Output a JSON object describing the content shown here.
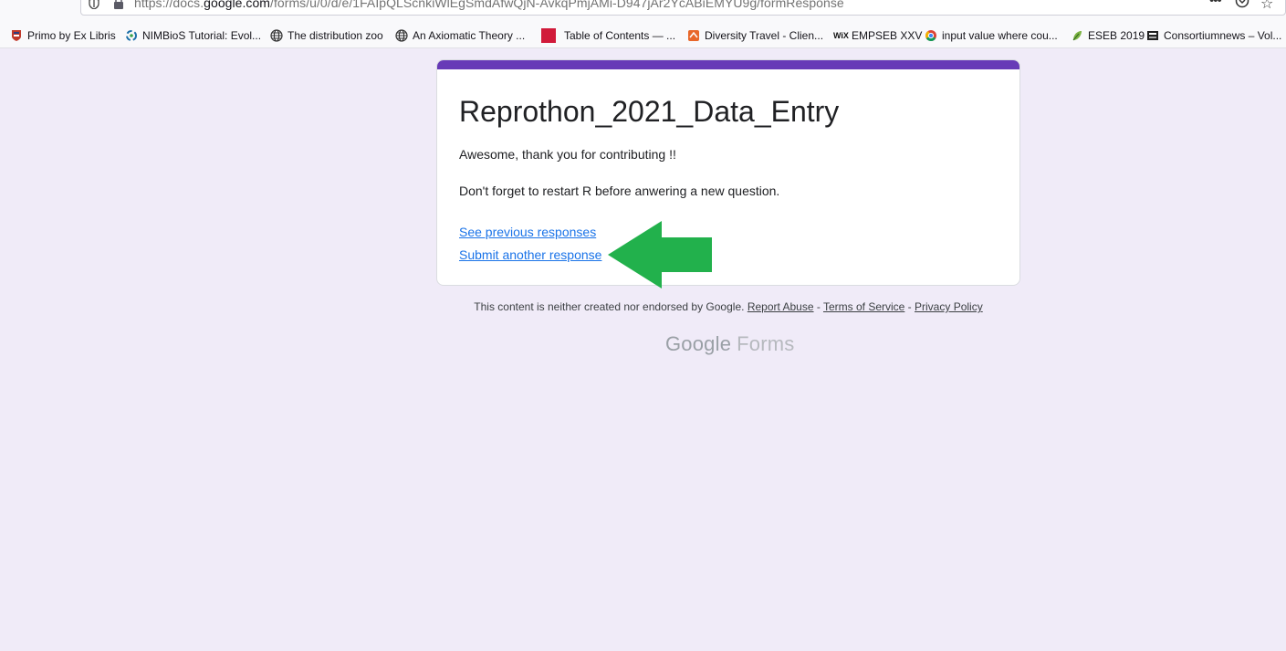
{
  "browser": {
    "url_prefix": "https://docs.",
    "url_host": "google.com",
    "url_path": "/forms/u/0/d/e/1FAIpQLScnkiWlEgSmdAfwQjN-AvkqPmjAMi-D947jAr2YcABiEMYU9g/formResponse",
    "icons": [
      "shield-icon",
      "lock-icon",
      "more-actions-icon",
      "pocket-icon",
      "bookmark-star-icon"
    ]
  },
  "bookmarks": [
    {
      "label": "Primo by Ex Libris",
      "icon": "primo-icon"
    },
    {
      "label": "NIMBioS Tutorial: Evol...",
      "icon": "nimbios-icon"
    },
    {
      "label": "The distribution zoo",
      "icon": "globe-icon"
    },
    {
      "label": "An Axiomatic Theory ...",
      "icon": "globe-icon"
    },
    {
      "label": "Table of Contents — ...",
      "icon": "red-square-icon"
    },
    {
      "label": "Diversity Travel - Clien...",
      "icon": "diversity-travel-icon"
    },
    {
      "label": "EMPSEB XXV",
      "icon": "wix-icon"
    },
    {
      "label": "input value where cou...",
      "icon": "chrome-icon"
    },
    {
      "label": "ESEB 2019",
      "icon": "leaf-icon"
    },
    {
      "label": "Consortiumnews – Vol...",
      "icon": "consortiumnews-icon"
    }
  ],
  "form": {
    "title": "Reprothon_2021_Data_Entry",
    "message_1": "Awesome, thank you for contributing !!",
    "message_2": "Don't forget to restart R before anwering a new question.",
    "link_previous": "See previous responses",
    "link_another": "Submit another response",
    "accent_color": "#673ab7",
    "arrow_color": "#22b14c"
  },
  "footer": {
    "disclaimer": "This content is neither created nor endorsed by Google.",
    "report_abuse": "Report Abuse",
    "sep": " - ",
    "terms": "Terms of Service",
    "privacy": "Privacy Policy",
    "logo_google": "Google",
    "logo_forms": "Forms"
  },
  "colors": {
    "background": "#f0ebf8",
    "link": "#1a73e8"
  }
}
